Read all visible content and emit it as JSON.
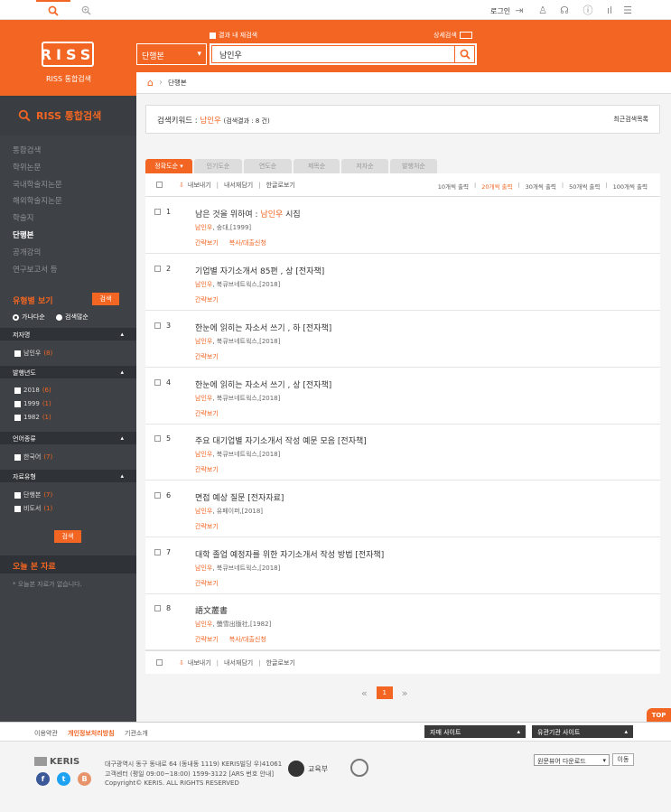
{
  "topbar": {
    "login": "로그인"
  },
  "header": {
    "logo": "RISS",
    "logo_sub": "RISS 통합검색",
    "within_label": "결과 내 재검색",
    "advanced_label": "상세검색",
    "type_select": "단행본",
    "query": "남인우"
  },
  "breadcrumb": {
    "current": "단행본"
  },
  "sidebar": {
    "title": "RISS 통합검색",
    "menu": [
      "통합검색",
      "학위논문",
      "국내학술지논문",
      "해외학술지논문",
      "학술지",
      "단행본",
      "공개강의",
      "연구보고서 등"
    ],
    "type_view": "유형별 보기",
    "type_btn": "검색",
    "radio": [
      "가나다순",
      "검색많순"
    ],
    "filters": [
      {
        "head": "저자명",
        "items": [
          {
            "label": "남인우",
            "count": "(8)"
          }
        ]
      },
      {
        "head": "발행년도",
        "items": [
          {
            "label": "2018",
            "count": "(6)"
          },
          {
            "label": "1999",
            "count": "(1)"
          },
          {
            "label": "1982",
            "count": "(1)"
          }
        ]
      },
      {
        "head": "언어종류",
        "items": [
          {
            "label": "한국어",
            "count": "(7)"
          }
        ]
      },
      {
        "head": "자료유형",
        "items": [
          {
            "label": "단행본",
            "count": "(7)"
          },
          {
            "label": "비도서",
            "count": "(1)"
          }
        ]
      }
    ],
    "search_btn": "검색",
    "today_title": "오늘 본 자료",
    "today_empty": "* 오늘본 자료가 없습니다."
  },
  "keyword": {
    "label": "검색키워드 :",
    "value": "남인우",
    "count": "(검색결과 : 8 건)",
    "recent": "최근검색목록"
  },
  "sort_tabs": [
    "정확도순 ▾",
    "인기도순",
    "연도순",
    "제목순",
    "저자순",
    "발행처순"
  ],
  "toolbar": {
    "export": "내보내기",
    "save": "내서재담기",
    "korean": "한글로보기",
    "per_page": [
      "10개씩 출력",
      "20개씩 출력",
      "30개씩 출력",
      "50개씩 출력",
      "100개씩 출력"
    ]
  },
  "results": [
    {
      "num": "1",
      "title_pre": "남은 것을 위하여 : ",
      "title_hl": "남인우",
      "title_post": " 시집",
      "author": "남인우",
      "pub": ", 숭대,[1999]",
      "acts": [
        "간략보기",
        "복사/대출신청"
      ]
    },
    {
      "num": "2",
      "title_pre": "기업별 자기소개서 85편 , 상 [전자책]",
      "title_hl": "",
      "title_post": "",
      "author": "남인우",
      "pub": ", 북큐브네트웍스,[2018]",
      "acts": [
        "간략보기"
      ]
    },
    {
      "num": "3",
      "title_pre": "한눈에 읽히는 자소서 쓰기 , 하 [전자책]",
      "title_hl": "",
      "title_post": "",
      "author": "남인우",
      "pub": ", 북큐브네트웍스,[2018]",
      "acts": [
        "간략보기"
      ]
    },
    {
      "num": "4",
      "title_pre": "한눈에 읽히는 자소서 쓰기 , 상 [전자책]",
      "title_hl": "",
      "title_post": "",
      "author": "남인우",
      "pub": ", 북큐브네트웍스,[2018]",
      "acts": [
        "간략보기"
      ]
    },
    {
      "num": "5",
      "title_pre": "주요 대기업별 자기소개서 작성 예문 모음 [전자책]",
      "title_hl": "",
      "title_post": "",
      "author": "남인우",
      "pub": ", 북큐브네트웍스,[2018]",
      "acts": [
        "간략보기"
      ]
    },
    {
      "num": "6",
      "title_pre": "면접 예상 질문 [전자자료]",
      "title_hl": "",
      "title_post": "",
      "author": "남인우",
      "pub": ", 유페이퍼,[2018]",
      "acts": [
        "간략보기"
      ]
    },
    {
      "num": "7",
      "title_pre": "대학 졸업 예정자를 위한 자기소개서 작성 방법 [전자책]",
      "title_hl": "",
      "title_post": "",
      "author": "남인우",
      "pub": ", 북큐브네트웍스,[2018]",
      "acts": [
        "간략보기"
      ]
    },
    {
      "num": "8",
      "title_pre": "語文叢書",
      "title_hl": "",
      "title_post": "",
      "author": "남인우",
      "pub": ", 螢雪出版社,[1982]",
      "acts": [
        "간략보기",
        "복사/대출신청"
      ]
    }
  ],
  "pager": {
    "prev": "«",
    "page": "1",
    "next": "»"
  },
  "top": "TOP",
  "footer": {
    "links": [
      "이용약관",
      "개인정보처리방침",
      "기관소개"
    ],
    "family": "자매 사이트",
    "related": "유관기관 사이트",
    "keris": "KERIS",
    "addr1": "대구광역시 동구 동내로 64 (동내동 1119) KERIS빌딩 우)41061",
    "addr2": "고객센터 (평일 09:00~18:00) 1599-3122 [ARS 번호 안내]",
    "addr3": "Copyright© KERIS. ALL RIGHTS RESERVED",
    "moe": "교육부",
    "download": "원문뷰어 다운로드",
    "go": "이동"
  }
}
